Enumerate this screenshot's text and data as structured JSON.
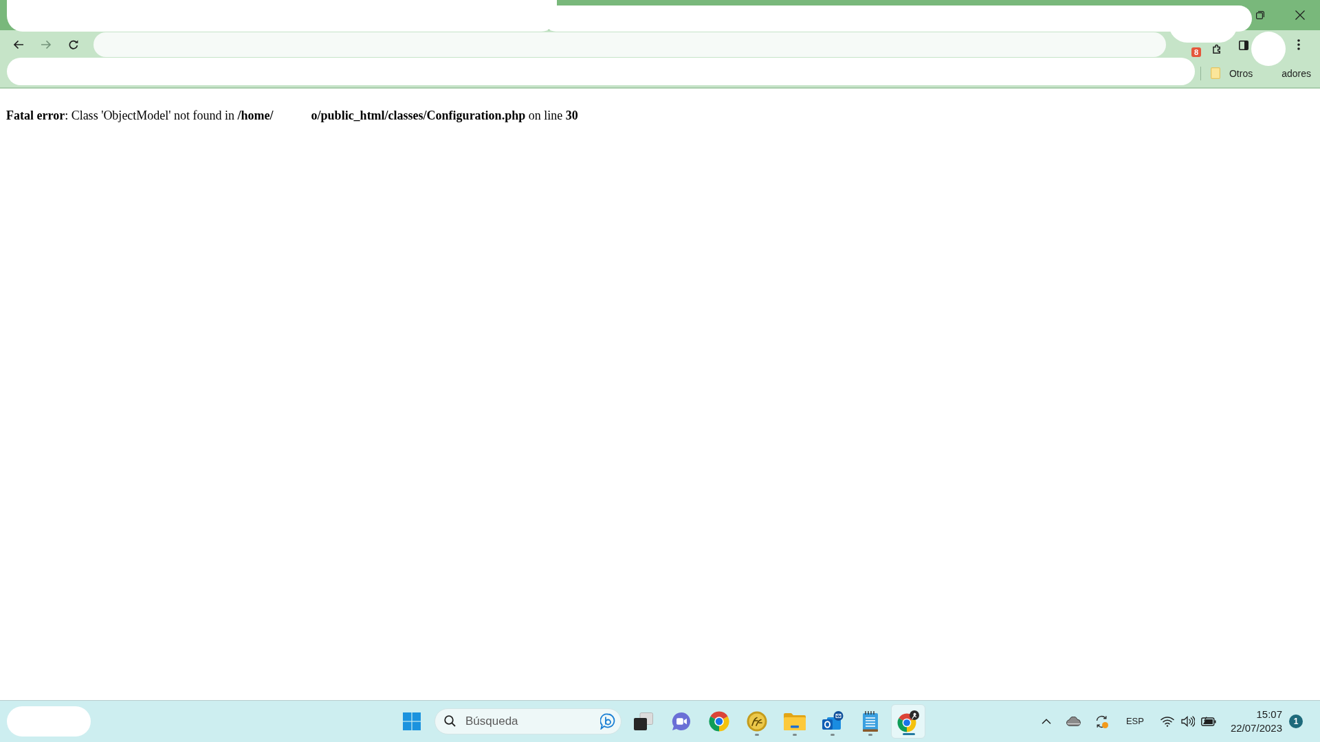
{
  "browser": {
    "nav_buttons": [
      {
        "kind": "back",
        "disabled": false
      },
      {
        "kind": "forward",
        "disabled": true
      },
      {
        "kind": "reload",
        "disabled": false
      }
    ],
    "extension_badge": "8",
    "bookmarks_bar": {
      "other_bookmarks": {
        "label_start": "Otros",
        "label_end": "adores"
      }
    }
  },
  "page": {
    "error_message_parts": [
      "**Fatal error**: Class 'ObjectModel' not found in **/home/**",
      "**o/public_html/classes/Configuration.php** on line **30**"
    ]
  },
  "taskbar": {
    "search": {
      "placeholder": "Búsqueda"
    },
    "apps": [
      {
        "kind": "tasks",
        "running": false,
        "selected": false
      },
      {
        "kind": "chat",
        "running": false,
        "selected": false
      },
      {
        "kind": "browser",
        "running": false,
        "selected": false
      },
      {
        "kind": "coin",
        "running": true,
        "selected": false
      },
      {
        "kind": "folder",
        "running": true,
        "selected": false
      },
      {
        "kind": "mail",
        "running": true,
        "selected": false
      },
      {
        "kind": "notes",
        "running": true,
        "selected": false
      },
      {
        "kind": "browserprofile",
        "running": true,
        "selected": true
      }
    ],
    "tray": {
      "language": "ESP",
      "time": "15:07",
      "date": "22/07/2023",
      "notification_count": "1"
    }
  }
}
